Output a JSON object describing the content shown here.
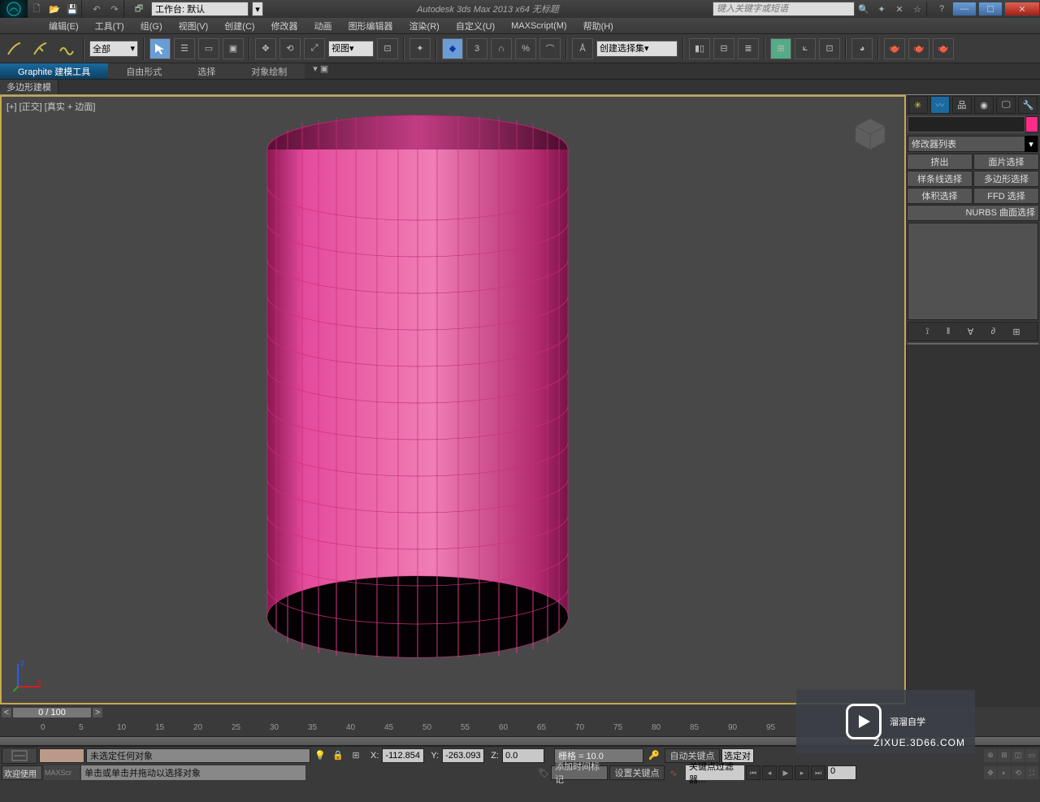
{
  "app_title": "Autodesk 3ds Max  2013 x64      无标题",
  "search_placeholder": "键入关键字或短语",
  "workspace_label": "工作台: 默认",
  "menus": {
    "edit": "编辑(E)",
    "tools": "工具(T)",
    "group": "组(G)",
    "views": "视图(V)",
    "create": "创建(C)",
    "modifiers": "修改器",
    "animation": "动画",
    "graph": "图形编辑器",
    "render": "渲染(R)",
    "custom": "自定义(U)",
    "maxscript": "MAXScript(M)",
    "help": "帮助(H)"
  },
  "toolbar": {
    "filter_all": "全部",
    "view_combo": "视图",
    "angle": "3",
    "sel_set": "创建选择集"
  },
  "ribbon": {
    "tab1": "Graphite 建模工具",
    "tab2": "自由形式",
    "tab3": "选择",
    "tab4": "对象绘制",
    "sub": "多边形建模"
  },
  "viewport_label": "[+] [正交] [真实 + 边面]",
  "cmd": {
    "mod_list": "修改器列表",
    "btn_extrude": "挤出",
    "btn_face": "面片选择",
    "btn_spline": "样条线选择",
    "btn_poly": "多边形选择",
    "btn_vol": "体积选择",
    "btn_ffd": "FFD 选择",
    "btn_nurbs": "NURBS 曲面选择"
  },
  "time": {
    "slider": "0 / 100",
    "ticks": [
      "5",
      "10",
      "15",
      "20",
      "25",
      "30",
      "35",
      "40",
      "45",
      "50",
      "55",
      "60",
      "65",
      "70",
      "75",
      "80",
      "85",
      "90",
      "95"
    ]
  },
  "status": {
    "no_sel": "未选定任何对象",
    "x": "-112.854",
    "y": "-263.093",
    "z": "0.0",
    "grid": "栅格 = 10.0",
    "autokey": "自动关键点",
    "selset": "选定对",
    "frame": "0"
  },
  "status2": {
    "welcome": "欢迎使用",
    "mxs": "MAXScr",
    "hint": "单击或单击并拖动以选择对象",
    "addtag": "添加时间标记",
    "setkey": "设置关键点",
    "keyfilter": "关键点过滤器..."
  },
  "watermark": {
    "brand": "溜溜自学",
    "url": "ZIXUE.3D66.COM"
  }
}
